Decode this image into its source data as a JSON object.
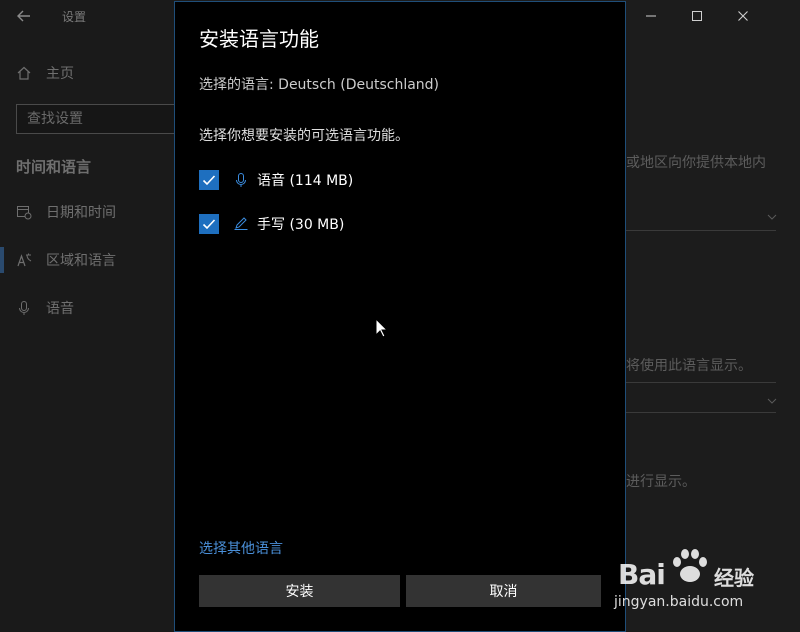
{
  "window": {
    "app_title": "设置",
    "controls": {
      "minimize": "minimize",
      "maximize": "maximize",
      "close": "close"
    }
  },
  "sidebar": {
    "home_label": "主页",
    "search_placeholder": "查找设置",
    "section_title": "时间和语言",
    "items": [
      {
        "label": "日期和时间",
        "icon": "calendar-clock-icon"
      },
      {
        "label": "区域和语言",
        "icon": "language-icon",
        "active": true
      },
      {
        "label": "语音",
        "icon": "microphone-icon"
      }
    ]
  },
  "background_page": {
    "fragment_1": "或地区向你提供本地内",
    "fragment_2": "将使用此语言显示。",
    "fragment_3": "进行显示。"
  },
  "dialog": {
    "title": "安装语言功能",
    "selected_language": "选择的语言: Deutsch (Deutschland)",
    "instruction": "选择你想要安装的可选语言功能。",
    "features": [
      {
        "label": "语音 (114 MB)",
        "icon": "microphone-icon",
        "checked": true
      },
      {
        "label": "手写 (30 MB)",
        "icon": "pen-icon",
        "checked": true
      }
    ],
    "other_language_link": "选择其他语言",
    "install_button": "安装",
    "cancel_button": "取消"
  },
  "watermark": {
    "brand": "Bai",
    "brand_suffix": "经验",
    "url": "jingyan.baidu.com"
  },
  "colors": {
    "accent": "#1e6fbf",
    "dialog_border": "#1f4e79",
    "link": "#4a8fd8",
    "button_bg": "#333333"
  }
}
